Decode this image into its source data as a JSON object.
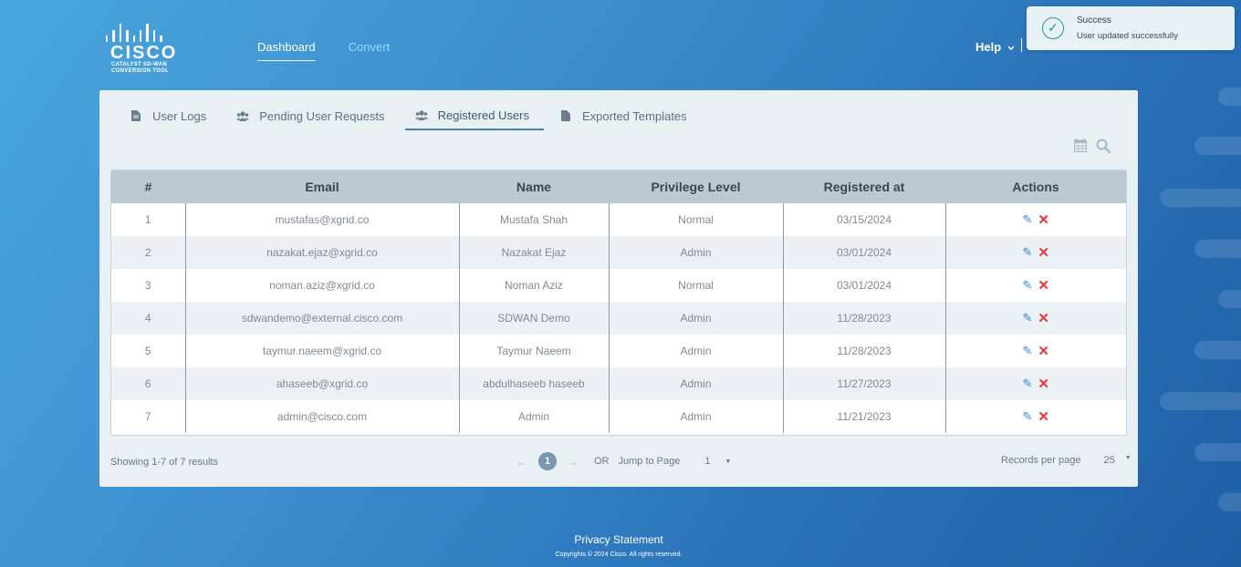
{
  "header": {
    "logo_word": "CISCO",
    "logo_line1": "CATALYST SD-WAN",
    "logo_line2": "CONVERSION TOOL",
    "nav": [
      {
        "label": "Dashboard",
        "active": true
      },
      {
        "label": "Convert",
        "active": false
      }
    ],
    "help_label": "Help",
    "help_caret_icon": "chevron-down-icon"
  },
  "toast": {
    "title": "Success",
    "message": "User updated successfully",
    "icon": "check-circle-icon",
    "color": "#1aa36b"
  },
  "tabs": [
    {
      "label": "User Logs",
      "icon": "file-icon",
      "active": false
    },
    {
      "label": "Pending User Requests",
      "icon": "users-icon",
      "active": false
    },
    {
      "label": "Registered Users",
      "icon": "users-icon",
      "active": true
    },
    {
      "label": "Exported Templates",
      "icon": "file-icon",
      "active": false
    }
  ],
  "tools": {
    "calendar_icon": "calendar-icon",
    "search_icon": "search-icon"
  },
  "table": {
    "columns": [
      "#",
      "Email",
      "Name",
      "Privilege Level",
      "Registered at",
      "Actions"
    ],
    "rows": [
      {
        "num": "1",
        "email": "mustafas@xgrid.co",
        "name": "Mustafa Shah",
        "privilege": "Normal",
        "registered": "03/15/2024"
      },
      {
        "num": "2",
        "email": "nazakat.ejaz@xgrid.co",
        "name": "Nazakat Ejaz",
        "privilege": "Admin",
        "registered": "03/01/2024"
      },
      {
        "num": "3",
        "email": "noman.aziz@xgrid.co",
        "name": "Noman Aziz",
        "privilege": "Normal",
        "registered": "03/01/2024"
      },
      {
        "num": "4",
        "email": "sdwandemo@external.cisco.com",
        "name": "SDWAN Demo",
        "privilege": "Admin",
        "registered": "11/28/2023"
      },
      {
        "num": "5",
        "email": "taymur.naeem@xgrid.co",
        "name": "Taymur Naeem",
        "privilege": "Admin",
        "registered": "11/28/2023"
      },
      {
        "num": "6",
        "email": "ahaseeb@xgrid.co",
        "name": "abdulhaseeb haseeb",
        "privilege": "Admin",
        "registered": "11/27/2023"
      },
      {
        "num": "7",
        "email": "admin@cisco.com",
        "name": "Admin",
        "privilege": "Admin",
        "registered": "11/21/2023"
      }
    ],
    "action_icons": [
      "edit-icon",
      "delete-icon"
    ]
  },
  "pagination": {
    "summary": "Showing 1-7 of 7 results",
    "current_page": "1",
    "or_label": "OR",
    "jump_label": "Jump to Page",
    "jump_value": "1",
    "records_label": "Records per page",
    "records_value": "25"
  },
  "footer": {
    "privacy": "Privacy Statement",
    "copyright": "Copyrights © 2024 Cisco. All rights reserved."
  },
  "colors": {
    "accent_blue": "#2d8fcf",
    "delete_red": "#e5383b",
    "nav_inactive": "#8fdcff"
  }
}
